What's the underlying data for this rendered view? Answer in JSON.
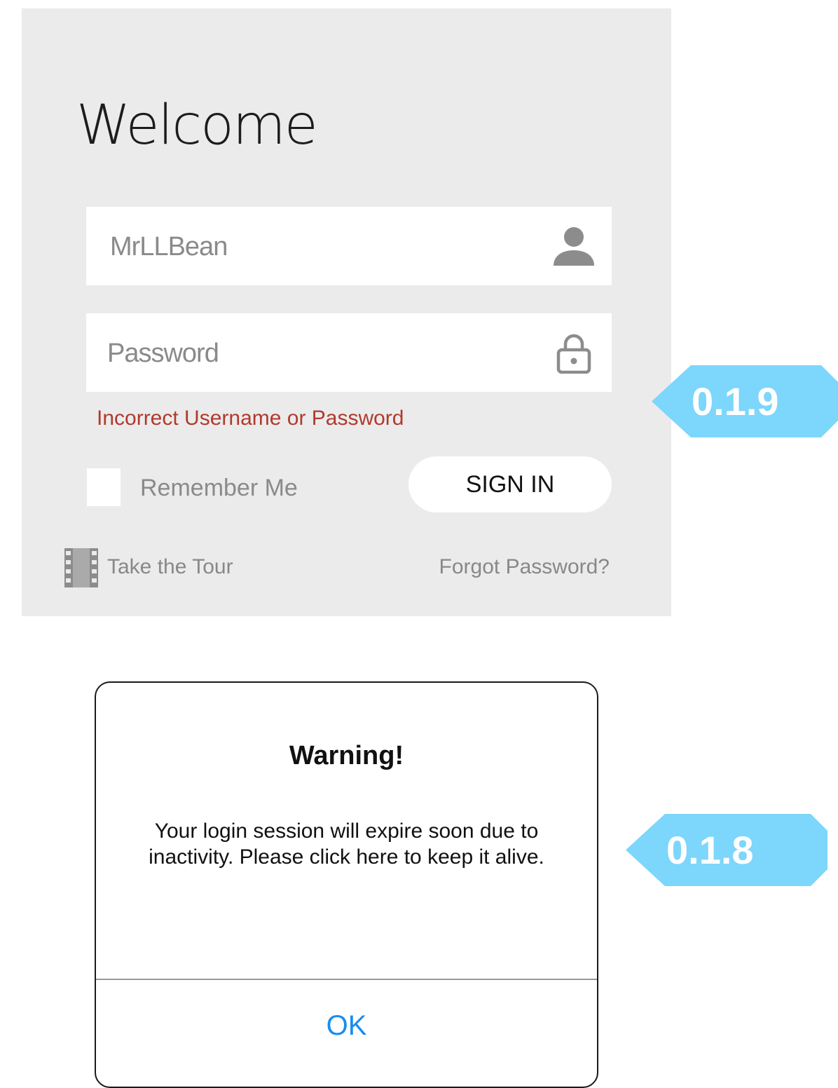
{
  "login": {
    "title": "Welcome",
    "username": {
      "value": "MrLLBean",
      "icon": "user-icon"
    },
    "password": {
      "placeholder": "Password",
      "icon": "lock-icon"
    },
    "error": "Incorrect Username or Password",
    "remember_label": "Remember Me",
    "signin_label": "SIGN IN",
    "tour": {
      "label": "Take the Tour",
      "icon": "film-icon"
    },
    "forgot_label": "Forgot Password?"
  },
  "callouts": [
    {
      "label": "0.1.9"
    },
    {
      "label": "0.1.8"
    }
  ],
  "dialog": {
    "title": "Warning!",
    "message": "Your login session will expire soon due to inactivity. Please click here to keep it alive.",
    "ok_label": "OK"
  },
  "colors": {
    "panel_background": "#ebebeb",
    "error": "#b03a2e",
    "callout": "#7dd6fb",
    "ok_link": "#1a8cf0"
  }
}
